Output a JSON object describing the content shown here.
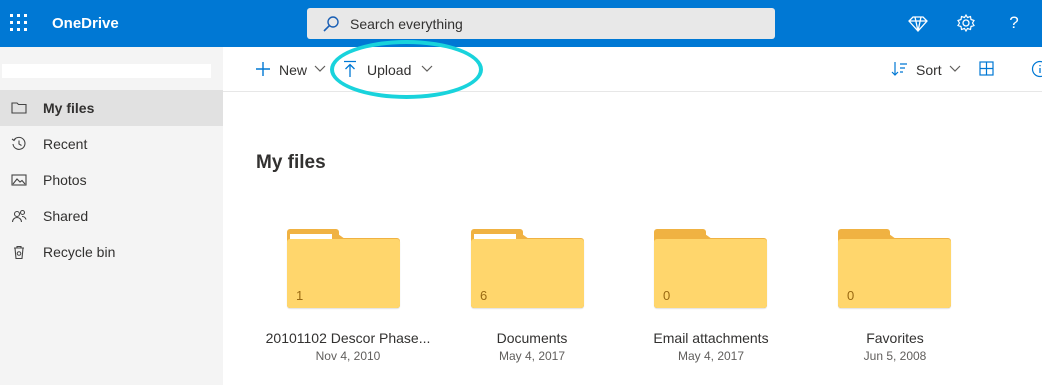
{
  "app": {
    "name": "OneDrive"
  },
  "topbar": {
    "bg_color": "#0078d4",
    "search_placeholder": "Search everything",
    "icons": [
      "app-launcher-icon",
      "search-icon",
      "premium-diamond-icon",
      "settings-gear-icon",
      "help-icon"
    ],
    "help_glyph": "?"
  },
  "sidebar": {
    "items": [
      {
        "label": "My files",
        "icon": "folder-icon",
        "active": true
      },
      {
        "label": "Recent",
        "icon": "history-icon"
      },
      {
        "label": "Photos",
        "icon": "photo-icon"
      },
      {
        "label": "Shared",
        "icon": "people-icon"
      },
      {
        "label": "Recycle bin",
        "icon": "trash-icon"
      }
    ]
  },
  "toolbar": {
    "new_label": "New",
    "upload_label": "Upload",
    "sort_label": "Sort",
    "upload_highlight_color": "#19d3dc"
  },
  "main": {
    "title": "My files",
    "folders": [
      {
        "name": "20101102 Descor Phase...",
        "date": "Nov 4, 2010",
        "count": "1"
      },
      {
        "name": "Documents",
        "date": "May 4, 2017",
        "count": "6"
      },
      {
        "name": "Email attachments",
        "date": "May 4, 2017",
        "count": "0"
      },
      {
        "name": "Favorites",
        "date": "Jun 5, 2008",
        "count": "0"
      }
    ],
    "folder_color": "#ffd66c"
  }
}
